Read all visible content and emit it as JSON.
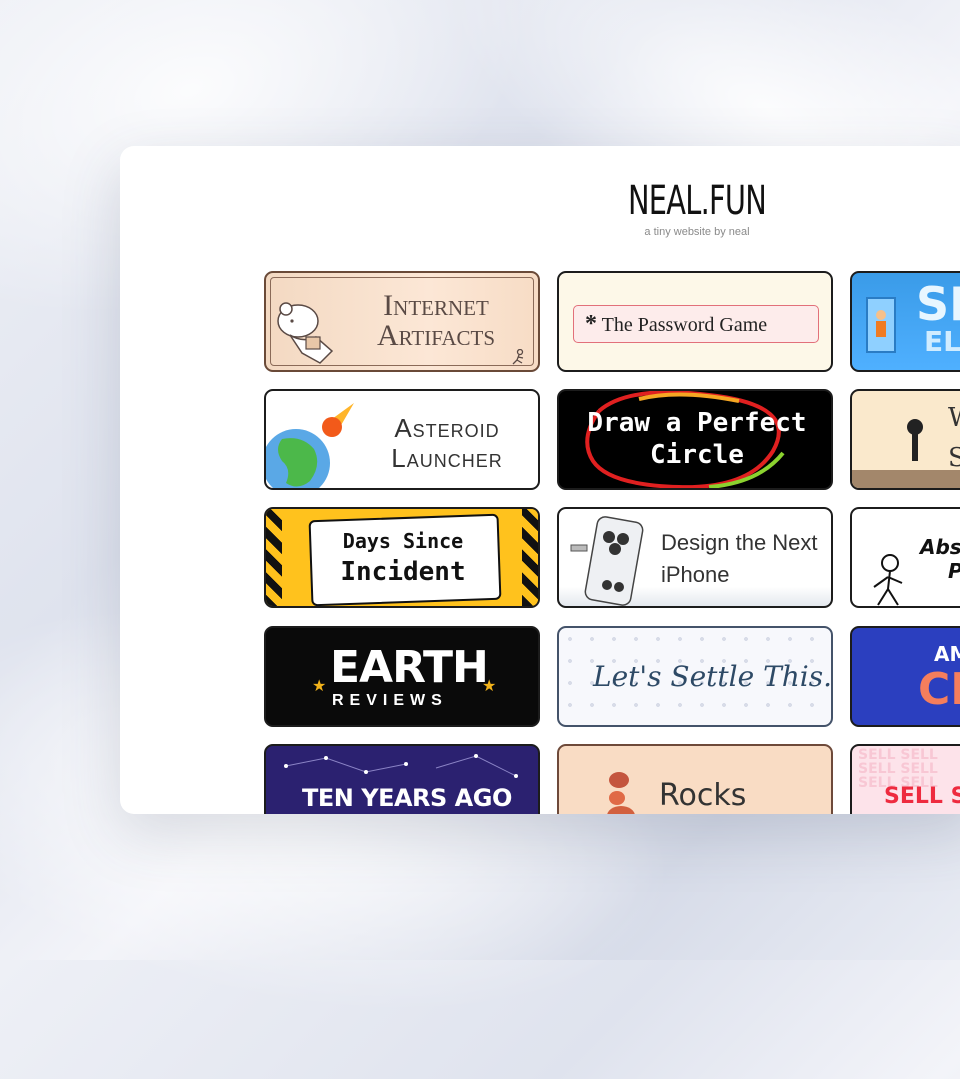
{
  "site": {
    "title": "NEAL.FUN",
    "subtitle": "a tiny website by neal"
  },
  "cards": {
    "internet_artifacts": "Internet Artifacts",
    "password_game": "The Password Game",
    "password_star": "*",
    "elevator_line1": "SP",
    "elevator_line2": "EL",
    "asteroid_launcher": "Asteroid Launcher",
    "perfect_circle": "Draw a Perfect Circle",
    "wind_line1": "W",
    "wind_line2": "S",
    "days_since_line1": "Days Since",
    "days_since_line2": "Incident",
    "design_iphone": "Design the Next iPhone",
    "absurd_line1": "Absu",
    "absurd_line2": "Pr",
    "earth_title": "EARTH",
    "earth_sub": "REVIEWS",
    "settle_this": "Let's Settle This.",
    "amc_line1": "AM",
    "amc_line2": "CH",
    "ten_years_ago": "TEN YEARS AGO",
    "rocks": "Rocks",
    "sell_bg": "SELL SELL SELL SELL SELL SELL",
    "sell_fg": "SELL S"
  },
  "colors": {
    "password_border": "#e2707a",
    "days_yellow": "#ffc21d",
    "elevator_blue": "#4fb0ff",
    "amc_blue": "#2b3fbf",
    "ten_years_purple": "#2b2170"
  }
}
